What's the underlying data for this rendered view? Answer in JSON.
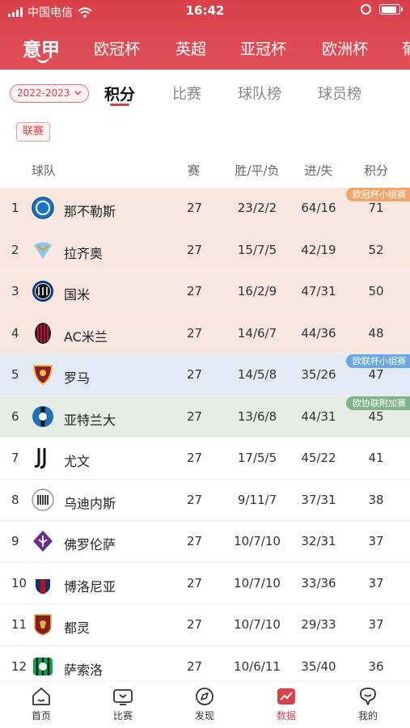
{
  "status_bar": {
    "carrier": "中国电信",
    "time": "16:42",
    "battery_level": 0.9
  },
  "league_tabs": [
    {
      "label": "意甲",
      "active": true
    },
    {
      "label": "欧冠杯",
      "active": false
    },
    {
      "label": "英超",
      "active": false
    },
    {
      "label": "亚冠杯",
      "active": false
    },
    {
      "label": "欧洲杯",
      "active": false
    },
    {
      "label": "葡",
      "active": false
    }
  ],
  "season_selector": {
    "value": "2022-2023"
  },
  "sub_tabs": [
    {
      "label": "积分",
      "active": true
    },
    {
      "label": "比赛",
      "active": false
    },
    {
      "label": "球队榜",
      "active": false
    },
    {
      "label": "球员榜",
      "active": false
    }
  ],
  "competition_chip": "联赛",
  "table": {
    "headers": {
      "team": "球队",
      "played": "赛",
      "wdl": "胜/平/负",
      "goals": "进/失",
      "points": "积分"
    },
    "rows": [
      {
        "rank": "1",
        "team": "那不勒斯",
        "logo": "napoli-crest-icon",
        "played": "27",
        "wdl": "23/2/2",
        "goals": "64/16",
        "points": "71",
        "zone": "ucl",
        "zone_label": "欧冠杯小组赛"
      },
      {
        "rank": "2",
        "team": "拉齐奥",
        "logo": "lazio-crest-icon",
        "played": "27",
        "wdl": "15/7/5",
        "goals": "42/19",
        "points": "52",
        "zone": "ucl",
        "zone_label": ""
      },
      {
        "rank": "3",
        "team": "国米",
        "logo": "inter-crest-icon",
        "played": "27",
        "wdl": "16/2/9",
        "goals": "47/31",
        "points": "50",
        "zone": "ucl",
        "zone_label": ""
      },
      {
        "rank": "4",
        "team": "AC米兰",
        "logo": "ac-milan-crest-icon",
        "played": "27",
        "wdl": "14/6/7",
        "goals": "44/36",
        "points": "48",
        "zone": "ucl",
        "zone_label": ""
      },
      {
        "rank": "5",
        "team": "罗马",
        "logo": "roma-crest-icon",
        "played": "27",
        "wdl": "14/5/8",
        "goals": "35/26",
        "points": "47",
        "zone": "uel",
        "zone_label": "欧联杯小组赛"
      },
      {
        "rank": "6",
        "team": "亚特兰大",
        "logo": "atalanta-crest-icon",
        "played": "27",
        "wdl": "13/6/8",
        "goals": "44/31",
        "points": "45",
        "zone": "uecl",
        "zone_label": "欧协联附加赛"
      },
      {
        "rank": "7",
        "team": "尤文",
        "logo": "juventus-crest-icon",
        "played": "27",
        "wdl": "17/5/5",
        "goals": "45/22",
        "points": "41",
        "zone": "none",
        "zone_label": ""
      },
      {
        "rank": "8",
        "team": "乌迪内斯",
        "logo": "udinese-crest-icon",
        "played": "27",
        "wdl": "9/11/7",
        "goals": "37/31",
        "points": "38",
        "zone": "none",
        "zone_label": ""
      },
      {
        "rank": "9",
        "team": "佛罗伦萨",
        "logo": "fiorentina-crest-icon",
        "played": "27",
        "wdl": "10/7/10",
        "goals": "32/31",
        "points": "37",
        "zone": "none",
        "zone_label": ""
      },
      {
        "rank": "10",
        "team": "博洛尼亚",
        "logo": "bologna-crest-icon",
        "played": "27",
        "wdl": "10/7/10",
        "goals": "33/36",
        "points": "37",
        "zone": "none",
        "zone_label": ""
      },
      {
        "rank": "11",
        "team": "都灵",
        "logo": "torino-crest-icon",
        "played": "27",
        "wdl": "10/7/10",
        "goals": "29/33",
        "points": "37",
        "zone": "none",
        "zone_label": ""
      },
      {
        "rank": "12",
        "team": "萨索洛",
        "logo": "sassuolo-crest-icon",
        "played": "27",
        "wdl": "10/6/11",
        "goals": "35/40",
        "points": "36",
        "zone": "none",
        "zone_label": ""
      }
    ]
  },
  "bottom_nav": [
    {
      "label": "首页",
      "icon": "home-icon",
      "active": false
    },
    {
      "label": "比赛",
      "icon": "match-tv-icon",
      "active": false
    },
    {
      "label": "发现",
      "icon": "discover-compass-icon",
      "active": false
    },
    {
      "label": "数据",
      "icon": "data-chart-icon",
      "active": true
    },
    {
      "label": "我的",
      "icon": "profile-icon",
      "active": false
    }
  ],
  "colors": {
    "brand_red": "#d9404a",
    "ucl_bg": "#f7e7df",
    "uel_bg": "#e2ebf5",
    "uecl_bg": "#e4ece4"
  }
}
